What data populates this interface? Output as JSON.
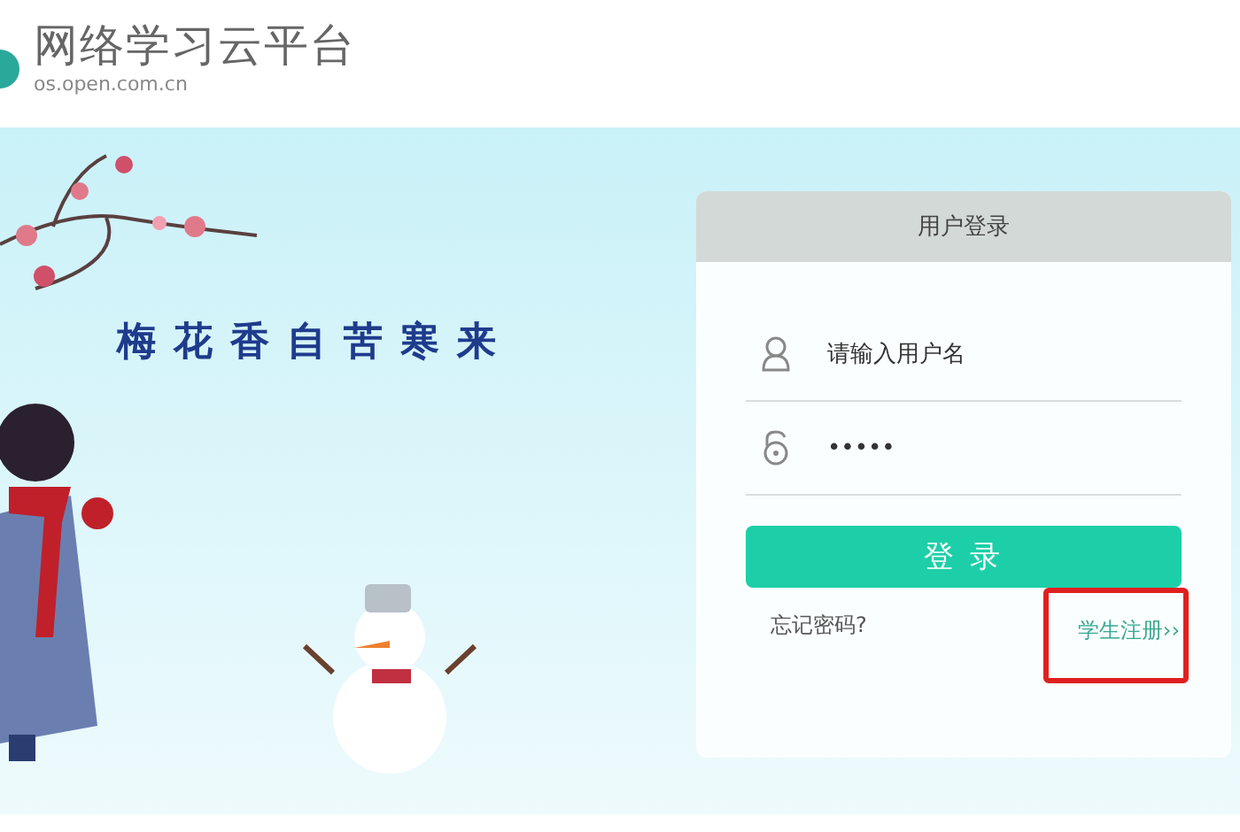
{
  "header": {
    "title": "网络学习云平台",
    "subtitle": "os.open.com.cn"
  },
  "banner": {
    "slogan": "梅花香自苦寒来"
  },
  "login": {
    "title": "用户登录",
    "username": {
      "placeholder": "请输入用户名"
    },
    "password": {
      "value": "•••••"
    },
    "submit": "登 录",
    "forgot": "忘记密码?",
    "register": "学生注册››",
    "register_highlighted": true
  }
}
